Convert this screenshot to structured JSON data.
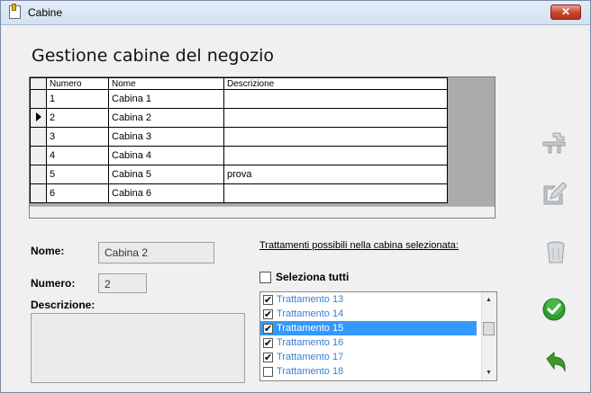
{
  "window": {
    "title": "Cabine",
    "close_label": "✕"
  },
  "heading": "Gestione cabine del negozio",
  "grid": {
    "columns": [
      "Numero",
      "Nome",
      "Descrizione"
    ],
    "rows": [
      {
        "numero": "1",
        "nome": "Cabina 1",
        "descrizione": ""
      },
      {
        "numero": "2",
        "nome": "Cabina 2",
        "descrizione": ""
      },
      {
        "numero": "3",
        "nome": "Cabina 3",
        "descrizione": ""
      },
      {
        "numero": "4",
        "nome": "Cabina 4",
        "descrizione": ""
      },
      {
        "numero": "5",
        "nome": "Cabina 5",
        "descrizione": "prova"
      },
      {
        "numero": "6",
        "nome": "Cabina 6",
        "descrizione": ""
      }
    ],
    "current_row": 2
  },
  "form": {
    "nome_label": "Nome:",
    "nome_value": "Cabina 2",
    "numero_label": "Numero:",
    "numero_value": "2",
    "descrizione_label": "Descrizione:",
    "descrizione_value": ""
  },
  "trattamenti": {
    "label": "Trattamenti possibili nella cabina selezionata:",
    "select_all_label": "Seleziona tutti",
    "select_all_checked": false,
    "items": [
      {
        "label": "Trattamento 13",
        "checked": true,
        "selected": false
      },
      {
        "label": "Trattamento 14",
        "checked": true,
        "selected": false
      },
      {
        "label": "Trattamento 15",
        "checked": true,
        "selected": true
      },
      {
        "label": "Trattamento 16",
        "checked": true,
        "selected": false
      },
      {
        "label": "Trattamento 17",
        "checked": true,
        "selected": false
      },
      {
        "label": "Trattamento 18",
        "checked": false,
        "selected": false
      }
    ]
  },
  "toolbar": {
    "icons": [
      "add-cabin-icon",
      "edit-icon",
      "delete-icon",
      "confirm-icon",
      "undo-icon"
    ],
    "colors": {
      "confirm": "#2f9e2f",
      "undo": "#3d9a2a",
      "disabled": "#c4c8cc"
    }
  }
}
